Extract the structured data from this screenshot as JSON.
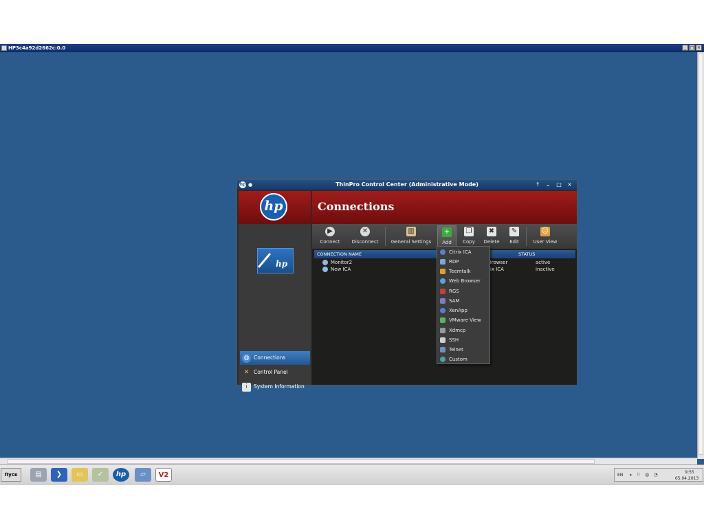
{
  "vnc": {
    "title": "HP3c4a92d2662c:0.0",
    "buttons": {
      "minimize": "_",
      "maximize": "□",
      "close": "×"
    }
  },
  "dialog": {
    "title": "ThinPro Control Center (Administrative Mode)",
    "window_controls": "↑ ⌄ □ ×",
    "hp_logo_text": "hp",
    "tile_text": "hp",
    "header_title": "Connections"
  },
  "sidebar": {
    "items": [
      {
        "label": "Connections",
        "icon": "globe-icon"
      },
      {
        "label": "Control Panel",
        "icon": "tools-icon"
      },
      {
        "label": "System Information",
        "icon": "info-icon"
      }
    ]
  },
  "toolbar": {
    "connect": "Connect",
    "disconnect": "Disconnect",
    "general_settings": "General Settings",
    "add": "Add",
    "copy": "Copy",
    "delete": "Delete",
    "edit": "Edit",
    "user_view": "User View"
  },
  "table": {
    "col_name": "CONNECTION NAME",
    "col_status": "STATUS",
    "rows": [
      {
        "name": "Monitor2",
        "type": "Browser",
        "status": "active"
      },
      {
        "name": "New ICA",
        "type": "rix ICA",
        "status": "inactive"
      }
    ]
  },
  "add_menu": {
    "items": [
      "Citrix ICA",
      "RDP",
      "Teemtalk",
      "Web Browser",
      "RGS",
      "SAM",
      "XenApp",
      "VMware View",
      "Xdmcp",
      "SSH",
      "Telnet",
      "Custom"
    ]
  },
  "taskbar": {
    "start_label": "Пуск",
    "lang": "EN",
    "time": "9:55",
    "date": "05.04.2013"
  },
  "colors": {
    "desktop": "#2a5b8c",
    "header_red": "#8b1414",
    "accent_blue": "#2b5a92"
  }
}
